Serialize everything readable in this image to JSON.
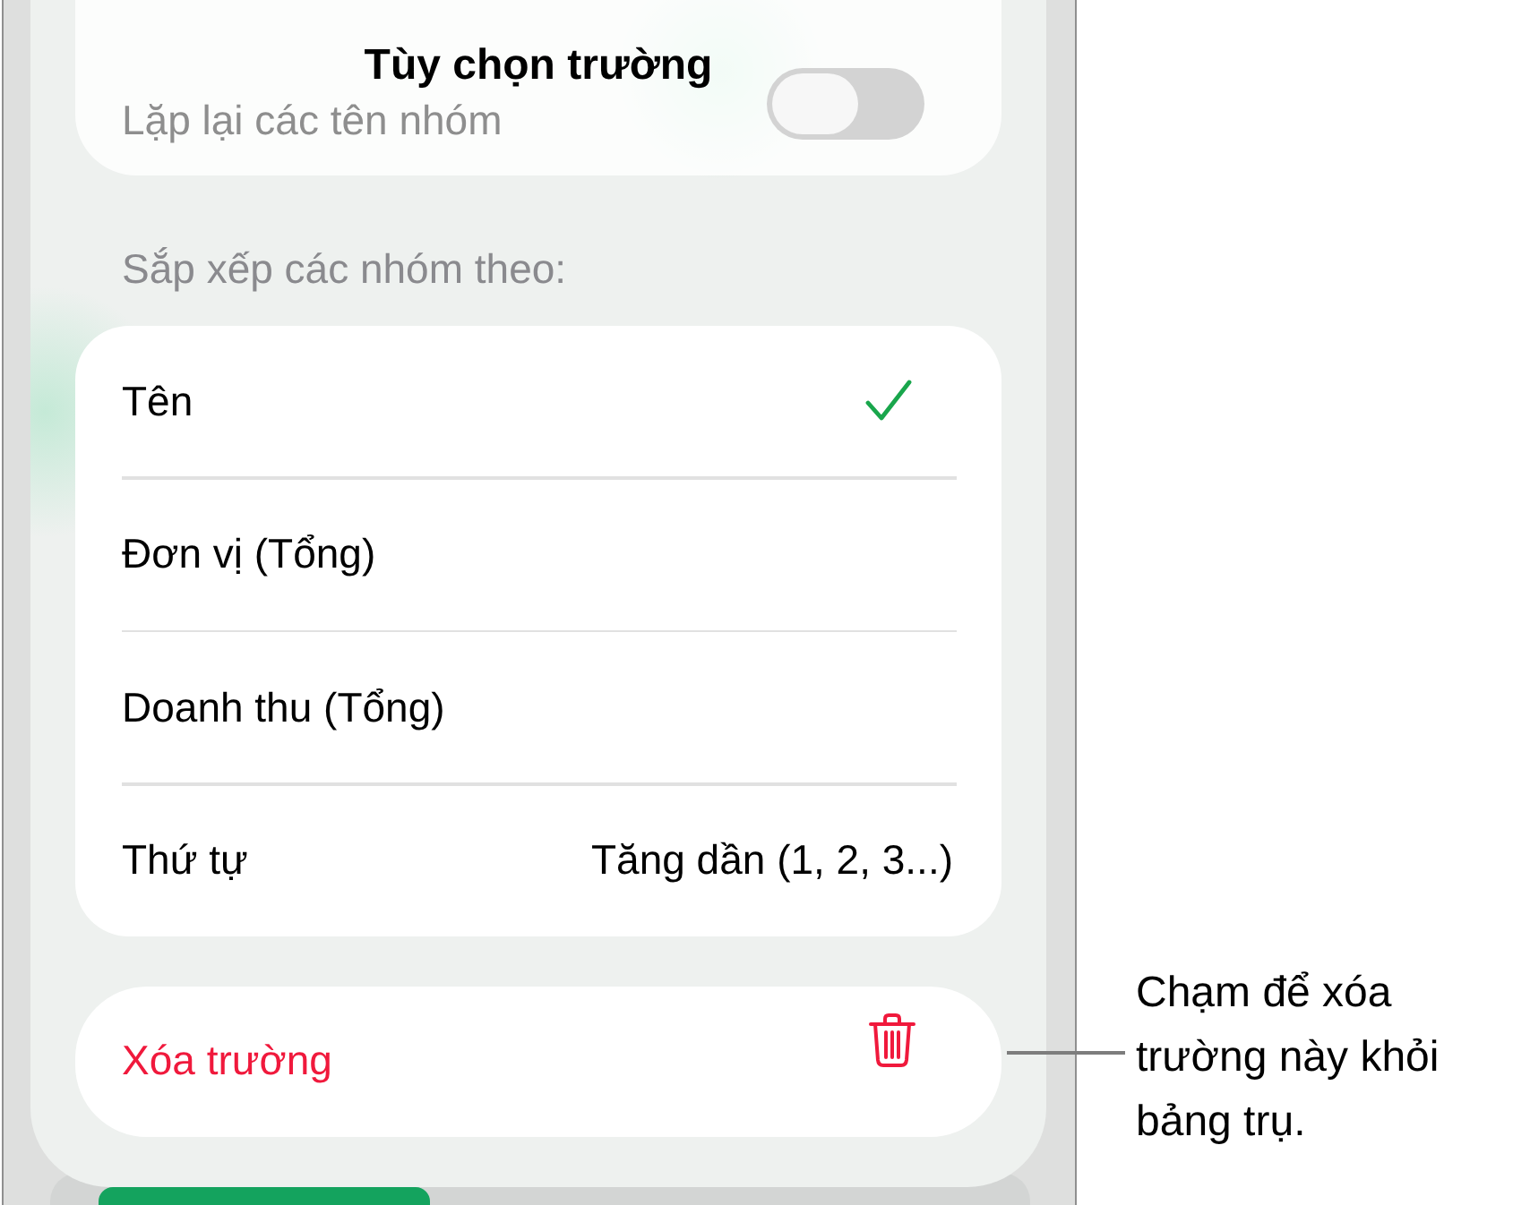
{
  "title": "Tùy chọn trường",
  "repeat_names": {
    "label": "Lặp lại các tên nhóm",
    "on": false
  },
  "sort_section": {
    "label": "Sắp xếp các nhóm theo:",
    "options": [
      {
        "label": "Tên",
        "selected": true
      },
      {
        "label": "Đơn vị (Tổng)",
        "selected": false
      },
      {
        "label": "Doanh thu (Tổng)",
        "selected": false
      }
    ],
    "order": {
      "label": "Thứ tự",
      "value": "Tăng dần (1, 2, 3...)"
    }
  },
  "delete_button": {
    "label": "Xóa trường"
  },
  "callout": "Chạm để xóa trường này khỏi bảng trụ."
}
